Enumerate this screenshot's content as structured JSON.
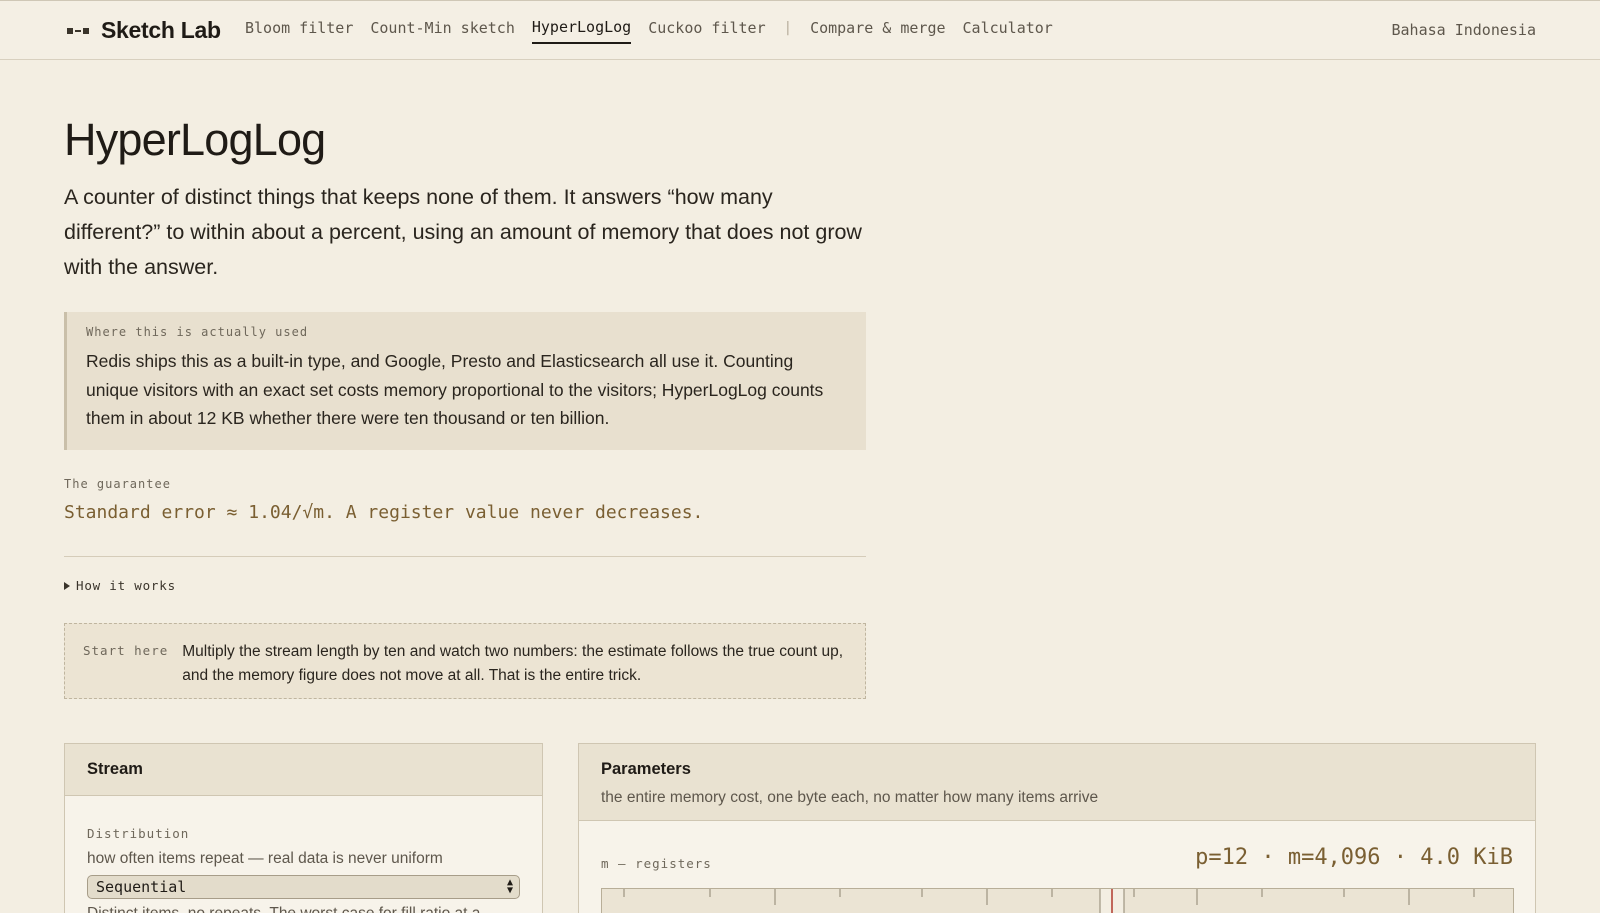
{
  "brand": {
    "name": "Sketch Lab",
    "icon": "sketch-lab-logo-icon"
  },
  "nav": {
    "items": [
      "Bloom filter",
      "Count-Min sketch",
      "HyperLogLog",
      "Cuckoo filter",
      "Compare & merge",
      "Calculator"
    ],
    "active": "HyperLogLog",
    "separator": "|"
  },
  "language": "Bahasa Indonesia",
  "page": {
    "title": "HyperLogLog",
    "lede": "A counter of distinct things that keeps none of them. It answers “how many different?” to within about a percent, using an amount of memory that does not grow with the answer."
  },
  "callout": {
    "label": "Where this is actually used",
    "body": "Redis ships this as a built-in type, and Google, Presto and Elasticsearch all use it. Counting unique visitors with an exact set costs memory proportional to the visitors; HyperLogLog counts them in about 12 KB whether there were ten thousand or ten billion."
  },
  "guarantee": {
    "label": "The guarantee",
    "text": "Standard error ≈ 1.04/√m. A register value never decreases."
  },
  "details": {
    "label": "How it works",
    "expanded": false
  },
  "start_here": {
    "label": "Start here",
    "body": "Multiply the stream length by ten and watch two numbers: the estimate follows the true count up, and the memory figure does not move at all. That is the entire trick."
  },
  "stream_panel": {
    "title": "Stream",
    "field_label": "Distribution",
    "field_help": "how often items repeat — real data is never uniform",
    "select_value": "Sequential",
    "select_desc": "Distinct items, no repeats. The worst case for fill ratio at a"
  },
  "params_panel": {
    "title": "Parameters",
    "subtitle": "the entire memory cost, one byte each, no matter how many items arrive",
    "register_label": "m — registers",
    "readout": "p=12 · m=4,096 · 4.0 KiB"
  },
  "colors": {
    "accent": "#7a5f32",
    "background": "#f3eee2",
    "marker": "#b03a2e"
  }
}
